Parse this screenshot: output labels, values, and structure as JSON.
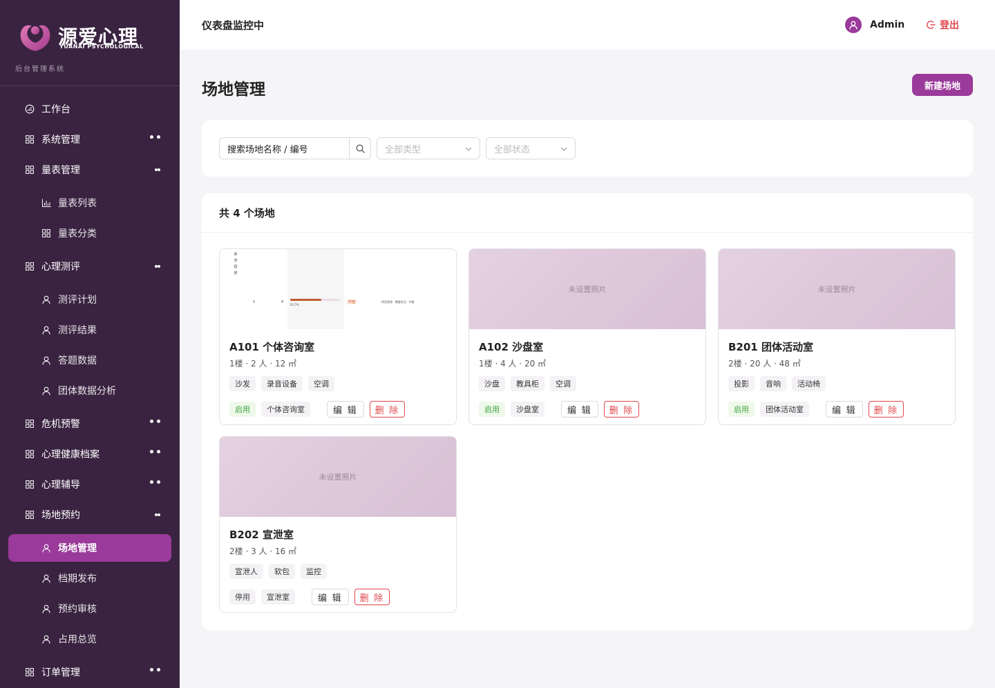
{
  "brand": {
    "name": "源爱心理",
    "name_en": "YUANAI PSYCHOLOGICAL",
    "subtitle": "后台管理系统"
  },
  "sidebar": {
    "items": [
      {
        "label": "工作台",
        "icon": "dashboard-icon",
        "level": 1
      },
      {
        "label": "系统管理",
        "icon": "grid-icon",
        "level": 1,
        "expanded": false
      },
      {
        "label": "量表管理",
        "icon": "grid-icon",
        "level": 1,
        "expanded": true
      },
      {
        "label": "量表列表",
        "icon": "bar-chart-icon",
        "level": 2
      },
      {
        "label": "量表分类",
        "icon": "grid-icon",
        "level": 2
      },
      {
        "label": "心理测评",
        "icon": "grid-icon",
        "level": 1,
        "expanded": true
      },
      {
        "label": "测评计划",
        "icon": "user-icon",
        "level": 2
      },
      {
        "label": "测评结果",
        "icon": "user-icon",
        "level": 2
      },
      {
        "label": "答题数据",
        "icon": "user-icon",
        "level": 2
      },
      {
        "label": "团体数据分析",
        "icon": "user-icon",
        "level": 2
      },
      {
        "label": "危机预警",
        "icon": "grid-icon",
        "level": 1,
        "expanded": false
      },
      {
        "label": "心理健康档案",
        "icon": "grid-icon",
        "level": 1,
        "expanded": false
      },
      {
        "label": "心理辅导",
        "icon": "grid-icon",
        "level": 1,
        "expanded": false
      },
      {
        "label": "场地预约",
        "icon": "grid-icon",
        "level": 1,
        "expanded": true
      },
      {
        "label": "场地管理",
        "icon": "user-icon",
        "level": 2,
        "active": true
      },
      {
        "label": "档期发布",
        "icon": "user-icon",
        "level": 2
      },
      {
        "label": "预约审核",
        "icon": "user-icon",
        "level": 2
      },
      {
        "label": "占用总览",
        "icon": "user-icon",
        "level": 2
      },
      {
        "label": "订单管理",
        "icon": "grid-icon",
        "level": 1,
        "expanded": false
      }
    ]
  },
  "header": {
    "title": "仪表盘监控中",
    "user": "Admin",
    "logout": "登出"
  },
  "page": {
    "title": "场地管理",
    "new_button": "新建场地"
  },
  "filters": {
    "search_value": "搜索场地名称 / 编号",
    "type_placeholder": "全部类型",
    "status_placeholder": "全部状态"
  },
  "list": {
    "summary": "共 4 个场地",
    "no_photo": "未设置照片",
    "edit_label": "编 辑",
    "delete_label": "删 除",
    "venues": [
      {
        "name": "A101 个体咨询室",
        "meta": "1楼 · 2 人 · 12 ㎡",
        "tags": [
          "沙发",
          "录音设备",
          "空调"
        ],
        "status": "启用",
        "type": "个体咨询室",
        "has_photo": true
      },
      {
        "name": "A102 沙盘室",
        "meta": "1楼 · 4 人 · 20 ㎡",
        "tags": [
          "沙盘",
          "教具柜",
          "空调"
        ],
        "status": "启用",
        "type": "沙盘室",
        "has_photo": false
      },
      {
        "name": "B201 团体活动室",
        "meta": "2楼 · 20 人 · 48 ㎡",
        "tags": [
          "投影",
          "音响",
          "活动椅"
        ],
        "status": "启用",
        "type": "团体活动室",
        "has_photo": false
      },
      {
        "name": "B202 宣泄室",
        "meta": "2楼 · 3 人 · 16 ㎡",
        "tags": [
          "宣泄人",
          "软包",
          "监控"
        ],
        "status": "停用",
        "type": "宣泄室",
        "has_photo": false
      }
    ]
  },
  "photo_thumb": {
    "left_label": "焦虑程度",
    "count_a": "5",
    "count_b": "8",
    "percent": "62.5%",
    "progress": 0.625,
    "level": "中度",
    "note": "明显焦虑 · 需要关注 · 中度"
  },
  "colors": {
    "sidebar_bg": "#3a2341",
    "accent": "#9a3a9a",
    "danger": "#e0474c",
    "success": "#3ea33e"
  }
}
